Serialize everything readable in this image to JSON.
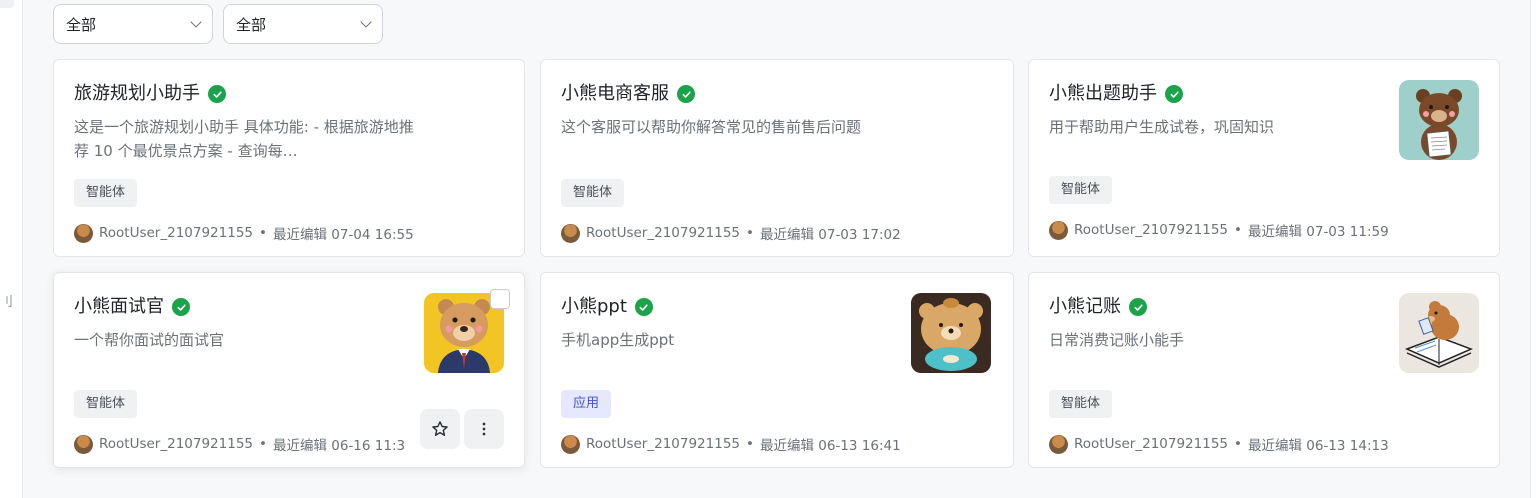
{
  "filters": [
    {
      "selected": "全部"
    },
    {
      "selected": "全部"
    }
  ],
  "left_rail": {
    "glyph": "刂"
  },
  "cards": [
    {
      "title": "旅游规划小助手",
      "description": "这是一个旅游规划小助手 具体功能: - 根据旅游地推荐 10 个最优景点方案 - 查询每…",
      "tag": "智能体",
      "user": "RootUser_2107921155",
      "edited": "最近编辑 07-04 16:55"
    },
    {
      "title": "小熊电商客服",
      "description": "这个客服可以帮助你解答常见的售前售后问题",
      "tag": "智能体",
      "user": "RootUser_2107921155",
      "edited": "最近编辑 07-03 17:02"
    },
    {
      "title": "小熊出题助手",
      "description": "用于帮助用户生成试卷，巩固知识",
      "tag": "智能体",
      "user": "RootUser_2107921155",
      "edited": "最近编辑 07-03 11:59"
    },
    {
      "title": "小熊面试官",
      "description": "一个帮你面试的面试官",
      "tag": "智能体",
      "user": "RootUser_2107921155",
      "edited": "最近编辑 06-16 11:3"
    },
    {
      "title": "小熊ppt",
      "description": "手机app生成ppt",
      "tag": "应用",
      "user": "RootUser_2107921155",
      "edited": "最近编辑 06-13 16:41"
    },
    {
      "title": "小熊记账",
      "description": "日常消费记账小能手",
      "tag": "智能体",
      "user": "RootUser_2107921155",
      "edited": "最近编辑 06-13 14:13"
    }
  ],
  "separator": "•",
  "colors": {
    "verified": "#1aa34a",
    "app_tag_bg": "#e6e8ff",
    "app_tag_text": "#4352d9"
  },
  "icons": {
    "verified": "check-circle-icon",
    "favorite": "star-icon",
    "more": "more-vertical-icon",
    "dropdown": "chevron-down-icon"
  }
}
